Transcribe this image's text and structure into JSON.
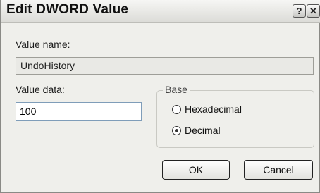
{
  "window": {
    "title": "Edit DWORD Value",
    "help_glyph": "?",
    "close_glyph": "✕"
  },
  "value_name": {
    "label": "Value name:",
    "value": "UndoHistory"
  },
  "value_data": {
    "label": "Value data:",
    "value": "100"
  },
  "base": {
    "legend": "Base",
    "options": [
      {
        "label": "Hexadecimal",
        "selected": false
      },
      {
        "label": "Decimal",
        "selected": true
      }
    ]
  },
  "buttons": {
    "ok": "OK",
    "cancel": "Cancel"
  }
}
